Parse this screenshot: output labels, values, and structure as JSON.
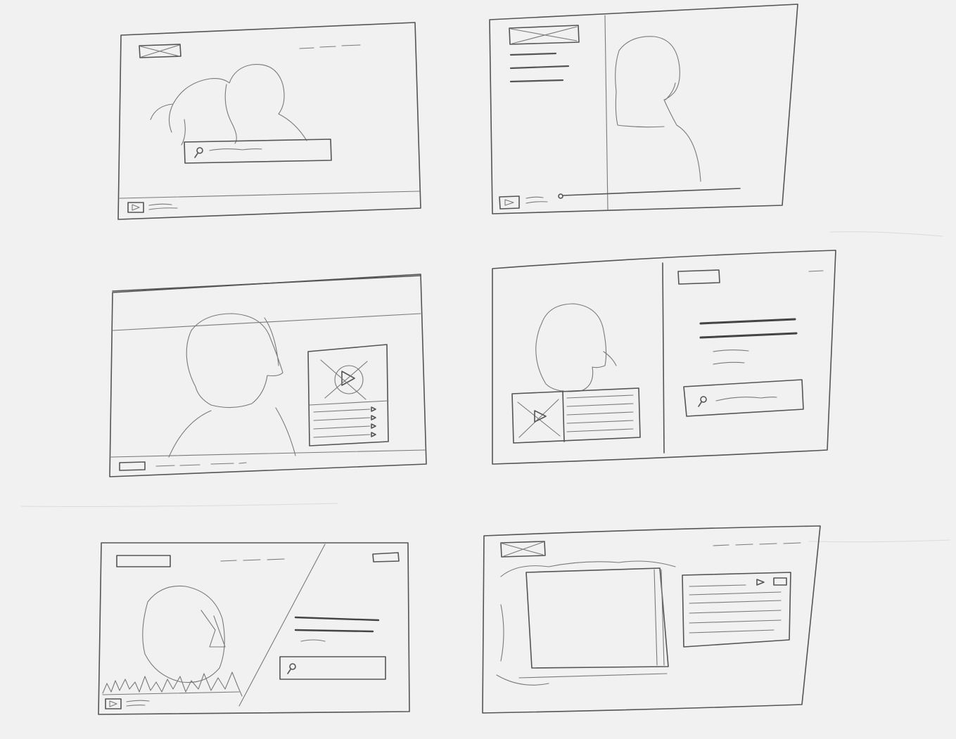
{
  "sketch": {
    "medium": "pencil",
    "colors": {
      "paper": "#f1f1f1",
      "pencil": "#555555",
      "pencil_light": "#7a7a7a"
    },
    "frames": [
      {
        "id": "frame-1",
        "elements": [
          "logo-placeholder",
          "nav-links",
          "hero-people",
          "search-box",
          "search-icon",
          "play-icon",
          "caption-lines"
        ]
      },
      {
        "id": "frame-2",
        "elements": [
          "logo-placeholder",
          "text-lines",
          "split-divider",
          "portrait",
          "play-icon",
          "progress-bar"
        ]
      },
      {
        "id": "frame-3",
        "elements": [
          "top-bar",
          "portrait",
          "video-panel",
          "play-icon",
          "playlist-items",
          "bottom-bar"
        ]
      },
      {
        "id": "frame-4",
        "elements": [
          "split-divider",
          "portrait",
          "video-thumbnail",
          "play-icon",
          "list-lines",
          "button-placeholder",
          "heading-lines",
          "search-box",
          "search-icon"
        ]
      },
      {
        "id": "frame-5",
        "elements": [
          "button-placeholder",
          "nav-links",
          "diagonal-split",
          "portrait",
          "audio-waveform",
          "heading-lines",
          "search-box",
          "search-icon",
          "play-icon"
        ]
      },
      {
        "id": "frame-6",
        "elements": [
          "logo-placeholder",
          "nav-links",
          "media-window",
          "playlist-popup",
          "play-icon"
        ]
      }
    ]
  }
}
